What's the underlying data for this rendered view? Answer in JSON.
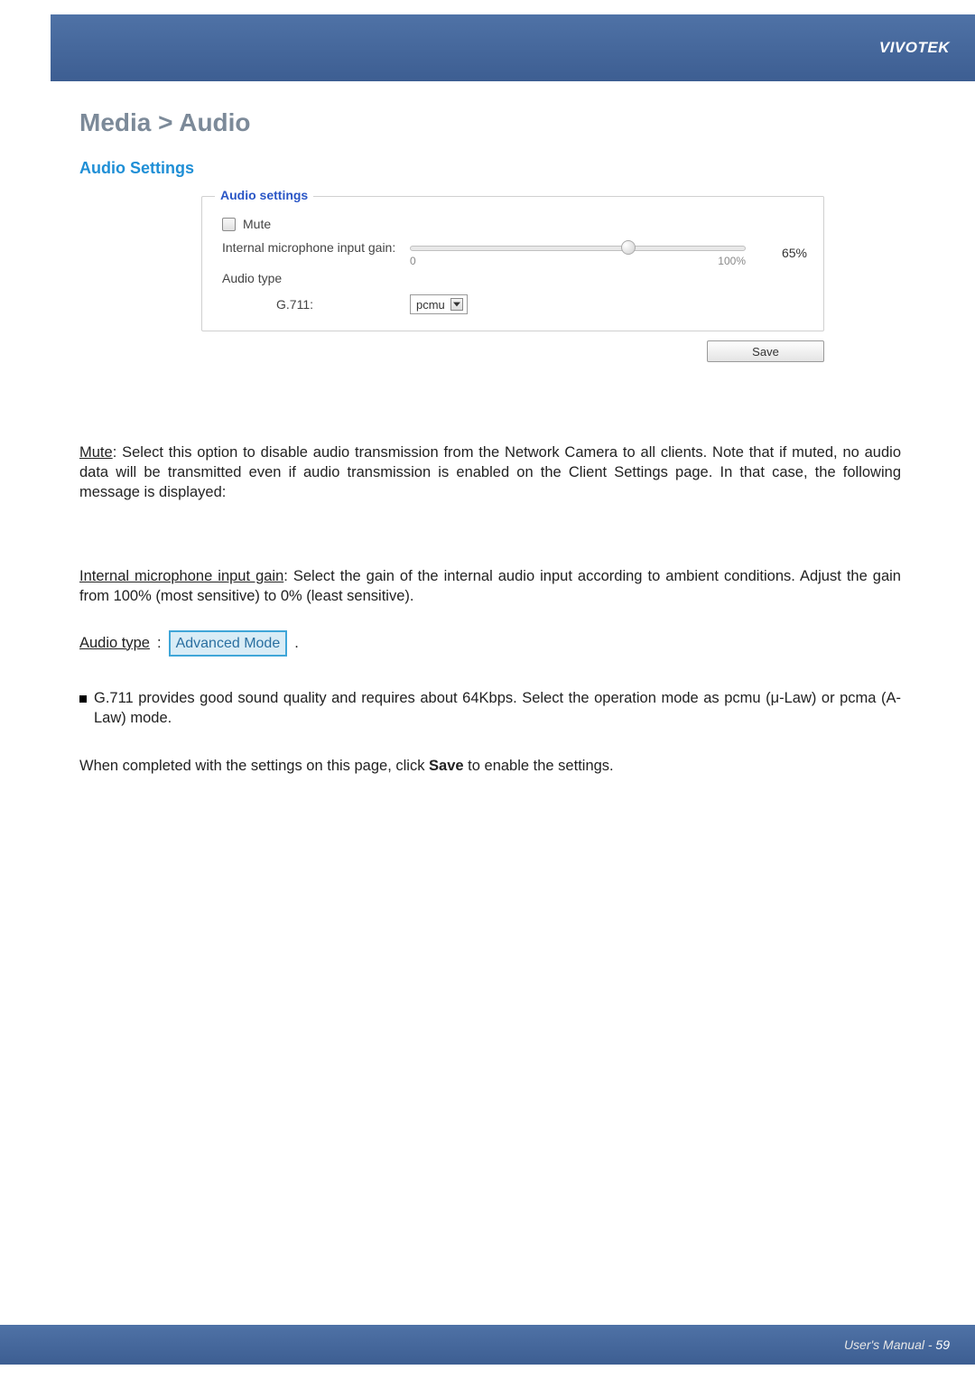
{
  "header": {
    "brand": "VIVOTEK"
  },
  "breadcrumb": "Media > Audio",
  "section_title": "Audio Settings",
  "fieldset": {
    "legend": "Audio settings",
    "mute_label": "Mute",
    "gain_label": "Internal microphone input gain:",
    "gain_min": "0",
    "gain_max": "100%",
    "gain_value": "65%",
    "audio_type_label": "Audio type",
    "g711_label": "G.711:",
    "g711_value": "pcmu"
  },
  "save_label": "Save",
  "doc": {
    "mute_term": "Mute",
    "mute_desc": ": Select this option to disable audio transmission from the Network Camera to all clients. Note that if muted, no audio data will be transmitted even if audio transmission is enabled on the Client Settings page. In that case, the following message is displayed:",
    "gain_term": "Internal microphone input gain",
    "gain_desc": ": Select the gain of the internal audio input according to ambient conditions. Adjust the gain from 100% (most sensitive) to 0% (least sensitive).",
    "audio_type_term": "Audio type",
    "adv_badge": "Advanced Mode",
    "g711_bullet": "G.711 provides good sound quality and requires about 64Kbps. Select the operation mode as pcmu (μ-Law) or pcma (A-Law) mode.",
    "final_pre": "When completed with the settings on this page, click ",
    "final_bold": "Save",
    "final_post": " to enable the settings."
  },
  "footer": {
    "text": "User's Manual - ",
    "page": "59"
  }
}
